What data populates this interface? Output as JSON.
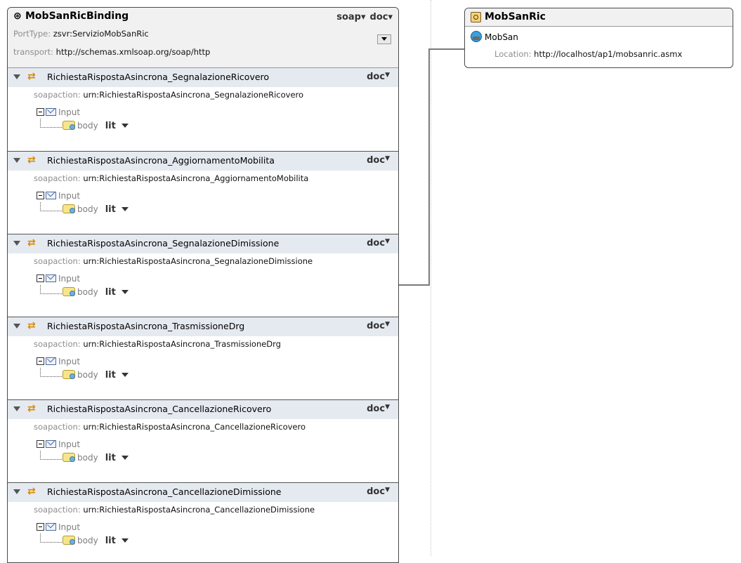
{
  "binding": {
    "title": "MobSanRicBinding",
    "protocol": "soap",
    "style": "doc",
    "porttype_label": "PortType:",
    "porttype_value": "zsvr:ServizioMobSanRic",
    "transport_label": "transport:",
    "transport_value": "http://schemas.xmlsoap.org/soap/http"
  },
  "operations": [
    {
      "name": "RichiestaRispostaAsincrona_SegnalazioneRicovero",
      "style": "doc",
      "soap_label": "soapaction:",
      "soap_value": "urn:RichiestaRispostaAsincrona_SegnalazioneRicovero",
      "input_label": "Input",
      "body_label": "body",
      "use": "lit"
    },
    {
      "name": "RichiestaRispostaAsincrona_AggiornamentoMobilita",
      "style": "doc",
      "soap_label": "soapaction:",
      "soap_value": "urn:RichiestaRispostaAsincrona_AggiornamentoMobilita",
      "input_label": "Input",
      "body_label": "body",
      "use": "lit"
    },
    {
      "name": "RichiestaRispostaAsincrona_SegnalazioneDimissione",
      "style": "doc",
      "soap_label": "soapaction:",
      "soap_value": "urn:RichiestaRispostaAsincrona_SegnalazioneDimissione",
      "input_label": "Input",
      "body_label": "body",
      "use": "lit"
    },
    {
      "name": "RichiestaRispostaAsincrona_TrasmissioneDrg",
      "style": "doc",
      "soap_label": "soapaction:",
      "soap_value": "urn:RichiestaRispostaAsincrona_TrasmissioneDrg",
      "input_label": "Input",
      "body_label": "body",
      "use": "lit"
    },
    {
      "name": "RichiestaRispostaAsincrona_CancellazioneRicovero",
      "style": "doc",
      "soap_label": "soapaction:",
      "soap_value": "urn:RichiestaRispostaAsincrona_CancellazioneRicovero",
      "input_label": "Input",
      "body_label": "body",
      "use": "lit"
    },
    {
      "name": "RichiestaRispostaAsincrona_CancellazioneDimissione",
      "style": "doc",
      "soap_label": "soapaction:",
      "soap_value": "urn:RichiestaRispostaAsincrona_CancellazioneDimissione",
      "input_label": "Input",
      "body_label": "body",
      "use": "lit"
    }
  ],
  "service": {
    "title": "MobSanRic",
    "port_name": "MobSan",
    "location_label": "Location:",
    "location_value": "http://localhost/ap1/mobsanric.asmx"
  },
  "colors": {
    "header_bg": "#f1f1f1",
    "operation_header_bg": "#e5e9f0",
    "arrow_accent": "#d88a00",
    "label_gray": "#8d8d8d"
  }
}
